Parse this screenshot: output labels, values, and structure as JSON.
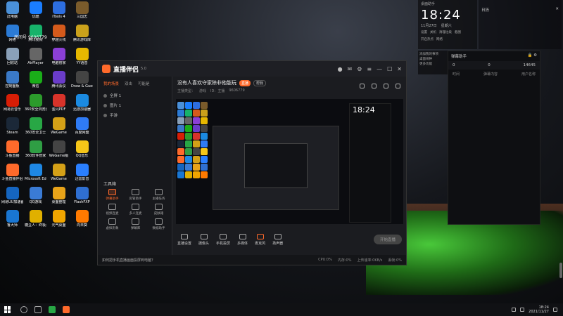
{
  "desktop_icons": [
    {
      "label": "此电脑",
      "color": "#4a90d9"
    },
    {
      "label": "优酷",
      "color": "#1a7dff"
    },
    {
      "label": "iTools 4",
      "color": "#2d6ee0"
    },
    {
      "label": "三国志",
      "color": "#7a5b2b"
    },
    {
      "label": "网络",
      "color": "#2b7bd6"
    },
    {
      "label": "腾讯视频",
      "color": "#17b26a"
    },
    {
      "label": "穿越火线",
      "color": "#d45a1b"
    },
    {
      "label": "腾讯游戏库",
      "color": "#caa11b"
    },
    {
      "label": "回收站",
      "color": "#8aa0b8"
    },
    {
      "label": "AirPlayer",
      "color": "#666"
    },
    {
      "label": "电脑管家",
      "color": "#8b3fd6"
    },
    {
      "label": "YY语音",
      "color": "#e6b800"
    },
    {
      "label": "控制面板",
      "color": "#3a79c7"
    },
    {
      "label": "微信",
      "color": "#1aad19"
    },
    {
      "label": "腾讯会议",
      "color": "#6a3cc9"
    },
    {
      "label": "Draw & Guess",
      "color": "#444"
    },
    {
      "label": "网易云音乐",
      "color": "#d81e06"
    },
    {
      "label": "360安全浏览器",
      "color": "#2c9b2c"
    },
    {
      "label": "金闪PDF",
      "color": "#d8332a"
    },
    {
      "label": "迅游加速器",
      "color": "#1b8ae0"
    },
    {
      "label": "Steam",
      "color": "#1b2838"
    },
    {
      "label": "360安全卫士",
      "color": "#28a745"
    },
    {
      "label": "WeGame",
      "color": "#d4a017"
    },
    {
      "label": "百度网盘",
      "color": "#2f7bf5"
    },
    {
      "label": "斗鱼直播",
      "color": "#ff6a2b"
    },
    {
      "label": "360软件管家",
      "color": "#2f9e44"
    },
    {
      "label": "WeGame版",
      "color": "#444"
    },
    {
      "label": "QQ音乐",
      "color": "#f5c518"
    },
    {
      "label": "斗鱼直播伴侣",
      "color": "#ff6a2b"
    },
    {
      "label": "Microsoft Edge",
      "color": "#1e88e5"
    },
    {
      "label": "WeGame",
      "color": "#d4a017"
    },
    {
      "label": "迅雷影音",
      "color": "#2a7fff"
    },
    {
      "label": "网易UU加速器",
      "color": "#1565c0"
    },
    {
      "label": "QQ游戏",
      "color": "#3a7bd5"
    },
    {
      "label": "桌面整理",
      "color": "#e8a319"
    },
    {
      "label": "FlashFXP",
      "color": "#2f6fd1"
    },
    {
      "label": "鲁大师",
      "color": "#1976d2"
    },
    {
      "label": "糖豆人：终极淘汰赛",
      "color": "#e0b000"
    },
    {
      "label": "元气桌面",
      "color": "#f0a500"
    },
    {
      "label": "向日葵",
      "color": "#ff7a00"
    }
  ],
  "app": {
    "title": "直播伴侣",
    "version": "5.0",
    "left_tabs": [
      "我的场景",
      "双击",
      "可能是"
    ],
    "scenes": [
      "全屏 1",
      "图片 1",
      "手游"
    ],
    "tools_title": "工具箱",
    "tools": [
      {
        "label": "弹幕助手",
        "hot": true
      },
      {
        "label": "房管助手",
        "hot": false
      },
      {
        "label": "主播任务",
        "hot": false
      },
      {
        "label": "视频连麦",
        "hot": false
      },
      {
        "label": "多人连麦",
        "hot": false
      },
      {
        "label": "皮肤箱",
        "hot": false
      },
      {
        "label": "虚拟形象",
        "hot": false
      },
      {
        "label": "弹幕库",
        "hot": false
      },
      {
        "label": "数据助手",
        "hot": false
      }
    ],
    "room_title": "没有人喜欢守家除非他能玩",
    "room_badge": "直播",
    "room_badge2": "帮我",
    "room_info": [
      "主播类型：",
      "游戏",
      "ID：主播",
      "9606779"
    ],
    "bottom_bar": [
      {
        "label": "直播设置",
        "hot": false
      },
      {
        "label": "摄像头",
        "hot": false
      },
      {
        "label": "手机投屏",
        "hot": false
      },
      {
        "label": "多媒体",
        "hot": false
      },
      {
        "label": "麦克风",
        "hot": true
      },
      {
        "label": "扬声器",
        "hot": false
      }
    ],
    "go_live": "开始直播",
    "status_tip": "如何把手机直播画面投屏到电脑？",
    "status_stats": [
      "CPU:0%",
      "内存:0%",
      "上传速率:0KB/s",
      "丢帧:0%"
    ]
  },
  "clock_widget": {
    "header": "桌面助手",
    "time": "18:24",
    "date": "11月27日",
    "weekday": "星期六",
    "actions": [
      "设置",
      "关机",
      "清理垃圾",
      "截图",
      "开启热点",
      "网络"
    ],
    "menu": [
      "添加我的事项",
      "桌面闹钟",
      "更多功能"
    ]
  },
  "right_box": {
    "title": "日历"
  },
  "chat_panel": {
    "title": "弹幕助手",
    "stats": [
      "0",
      "0",
      "14645"
    ],
    "cols": [
      "时间",
      "弹幕内容",
      "用户名称"
    ]
  },
  "taskbar": {
    "time": "18:24",
    "date": "2021/11/27"
  },
  "room_id": "9606779",
  "room_label": "房间号"
}
